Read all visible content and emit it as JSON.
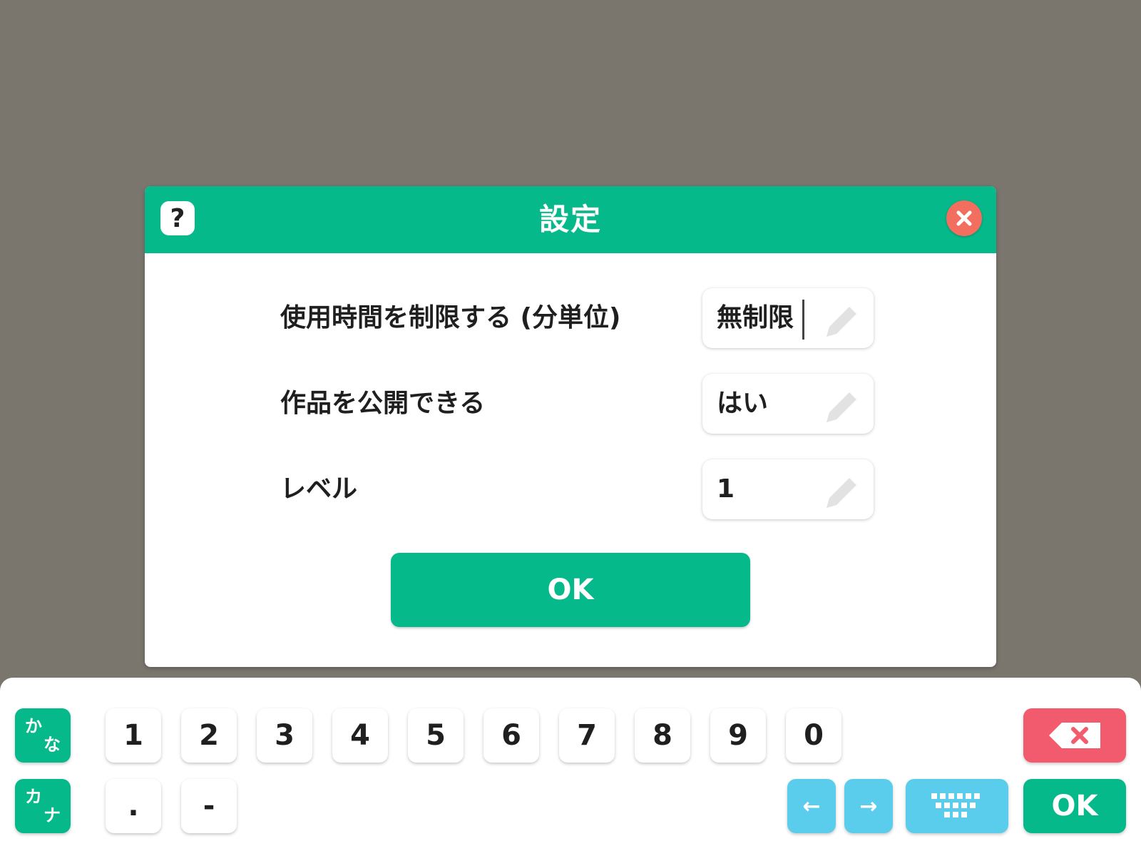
{
  "dialog": {
    "title": "設定",
    "help_label": "?",
    "rows": [
      {
        "label": "使用時間を制限する (分単位)",
        "value": "無制限"
      },
      {
        "label": "作品を公開できる",
        "value": "はい"
      },
      {
        "label": "レベル",
        "value": "1"
      }
    ],
    "ok_label": "OK"
  },
  "keyboard": {
    "hiragana_key": [
      "か",
      "な"
    ],
    "katakana_key": [
      "カ",
      "ナ"
    ],
    "digits": [
      "1",
      "2",
      "3",
      "4",
      "5",
      "6",
      "7",
      "8",
      "9",
      "0"
    ],
    "symbols": [
      ".",
      "-"
    ],
    "left_arrow": "←",
    "right_arrow": "→",
    "ok_label": "OK"
  },
  "colors": {
    "accent": "#06b98a",
    "close": "#f26e5f",
    "backspace": "#f25b6e",
    "arrow_keys": "#5bcdec",
    "overlay": "#7a766e"
  },
  "icons": {
    "help": "question-icon",
    "close": "close-icon",
    "edit": "pencil-icon",
    "backspace": "backspace-icon",
    "keyboard": "keyboard-icon"
  }
}
